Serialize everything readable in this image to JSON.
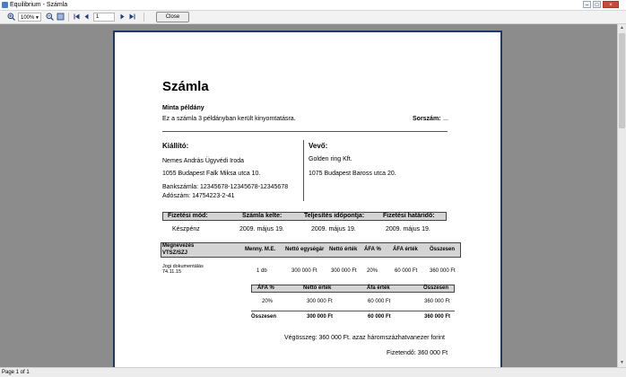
{
  "window": {
    "title": "Equilibrium - Számla",
    "min": "–",
    "max": "□",
    "close": "×"
  },
  "toolbar": {
    "zoom": "100%",
    "page_value": "1",
    "close_label": "Close"
  },
  "status": {
    "page_info": "Page 1 of 1"
  },
  "invoice": {
    "title": "Számla",
    "subtitle": "Minta példány",
    "copies_note": "Ez a számla 3 példányban került kinyomtatásra.",
    "serial_label": "Sorszám:",
    "serial_value": "...",
    "issuer": {
      "heading": "Kiállító:",
      "name": "Nemes András Ügyvédi Iroda",
      "address": "1055 Budapest Falk Miksa utca 10.",
      "bank": "Bankszámla: 12345678-12345678-12345678",
      "tax": "Adószám: 14754223-2-41"
    },
    "buyer": {
      "heading": "Vevő:",
      "name": "Golden ring Kft.",
      "address": "1075 Budapest Baross utca 20."
    },
    "payment": {
      "headers": [
        "Fizetési mód:",
        "Számla kelte:",
        "Teljesítés időpontja:",
        "Fizetési határidő:"
      ],
      "values": [
        "Készpénz",
        "2009. május 19.",
        "2009. május 19.",
        "2009. május 19."
      ]
    },
    "items": {
      "headers": {
        "name": "Megnevezés",
        "code": "VTSZ/SZJ",
        "qty": "Menny. M.E.",
        "unit_price": "Nettó egységár",
        "net": "Nettó érték",
        "vat": "ÁFA %",
        "vat_value": "ÁFA érték",
        "total": "Összesen"
      },
      "rows": [
        {
          "name": "Jogi dokumentálás",
          "code": "74.11.15",
          "qty": "1 db",
          "unit_price": "300 000 Ft",
          "net": "300 000 Ft",
          "vat": "20%",
          "vat_value": "60 000 Ft",
          "total": "360 000 Ft"
        }
      ]
    },
    "summary": {
      "headers": [
        "ÁFA %",
        "Nettó érték",
        "Áfa érték",
        "Összesen"
      ],
      "row": [
        "20%",
        "300 000 Ft",
        "60 000 Ft",
        "360 000 Ft"
      ],
      "total_row": [
        "Összesen",
        "300 000 Ft",
        "60 000 Ft",
        "360 000 Ft"
      ]
    },
    "grand_total": "Végösszeg: 360 000 Ft. azaz háromszázhatvanezer forint",
    "payable": "Fizetendő: 360 000 Ft"
  }
}
